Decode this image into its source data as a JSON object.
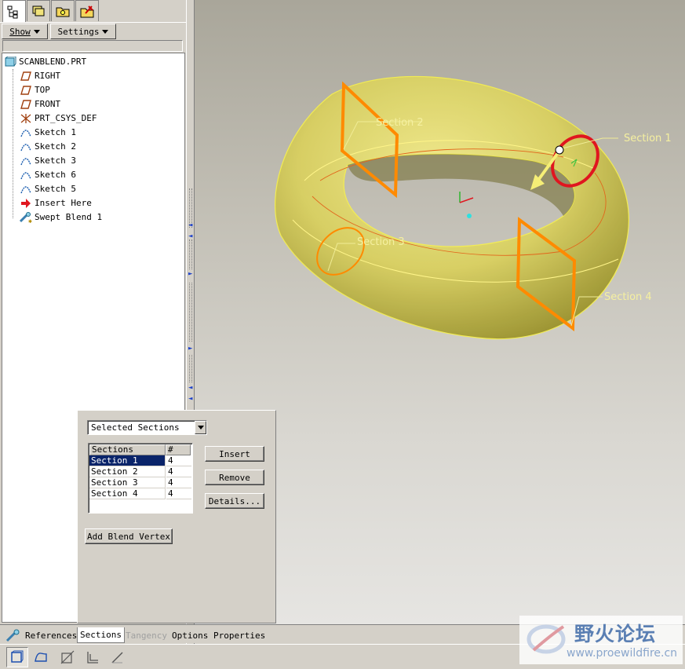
{
  "navigator": {
    "tabs": [
      {
        "icon": "model-tree-icon"
      },
      {
        "icon": "layers-icon"
      },
      {
        "icon": "folder-browser-icon"
      },
      {
        "icon": "favorites-tools-icon"
      }
    ],
    "show_label": "Show",
    "settings_label": "Settings",
    "tree": [
      {
        "label": "SCANBLEND.PRT",
        "icon": "part-icon"
      },
      {
        "label": "RIGHT",
        "icon": "datum-plane-icon"
      },
      {
        "label": "TOP",
        "icon": "datum-plane-icon"
      },
      {
        "label": "FRONT",
        "icon": "datum-plane-icon"
      },
      {
        "label": "PRT_CSYS_DEF",
        "icon": "csys-icon"
      },
      {
        "label": "Sketch 1",
        "icon": "sketch-icon"
      },
      {
        "label": "Sketch 2",
        "icon": "sketch-icon"
      },
      {
        "label": "Sketch 3",
        "icon": "sketch-icon"
      },
      {
        "label": "Sketch 6",
        "icon": "sketch-icon"
      },
      {
        "label": "Sketch 5",
        "icon": "sketch-icon"
      },
      {
        "label": "Insert Here",
        "icon": "insert-here-arrow-icon"
      },
      {
        "label": "Swept Blend 1",
        "icon": "swept-blend-icon"
      }
    ]
  },
  "viewport": {
    "section_labels": [
      "Section 1",
      "Section 2",
      "Section 3",
      "Section 4"
    ],
    "colors": {
      "body": "#e8e06a",
      "section_orange": "#ff8a00",
      "section_active": "#e0161f"
    }
  },
  "dashboard": {
    "selector_value": "Selected Sections",
    "table": {
      "headers": [
        "Sections",
        "#"
      ],
      "rows": [
        {
          "name": "Section 1",
          "count": "4",
          "selected": true
        },
        {
          "name": "Section 2",
          "count": "4"
        },
        {
          "name": "Section 3",
          "count": "4"
        },
        {
          "name": "Section 4",
          "count": "4"
        }
      ]
    },
    "buttons": {
      "insert": "Insert",
      "remove": "Remove",
      "details": "Details...",
      "add_blend_vertex": "Add Blend Vertex"
    }
  },
  "bottom_tabs": {
    "references": "References",
    "sections": "Sections",
    "tangency": "Tangency",
    "options": "Options",
    "properties": "Properties"
  },
  "bottom_toolbar": [
    "solid-icon",
    "surface-icon",
    "remove-material-icon",
    "thicken-icon",
    "sketch-line-icon"
  ],
  "watermark": {
    "title": "野火论坛",
    "url": "www.proewildfire.cn"
  }
}
